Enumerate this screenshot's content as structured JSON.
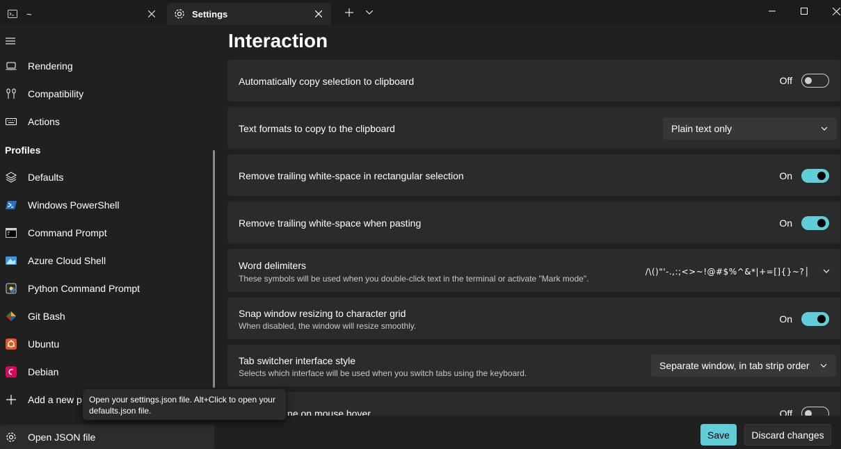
{
  "tabs": [
    {
      "title": "~",
      "icon": "terminal-icon"
    },
    {
      "title": "Settings",
      "icon": "gear-icon"
    }
  ],
  "sidebar": {
    "top_items": [
      {
        "label": "Rendering",
        "icon": "monitor-icon"
      },
      {
        "label": "Compatibility",
        "icon": "compatibility-icon"
      },
      {
        "label": "Actions",
        "icon": "keyboard-icon"
      }
    ],
    "profiles_header": "Profiles",
    "profiles": [
      {
        "label": "Defaults",
        "icon": "layers-icon"
      },
      {
        "label": "Windows PowerShell",
        "icon": "powershell-icon"
      },
      {
        "label": "Command Prompt",
        "icon": "cmd-icon"
      },
      {
        "label": "Azure Cloud Shell",
        "icon": "azure-icon"
      },
      {
        "label": "Python Command Prompt",
        "icon": "python-icon"
      },
      {
        "label": "Git Bash",
        "icon": "git-icon"
      },
      {
        "label": "Ubuntu",
        "icon": "ubuntu-icon"
      },
      {
        "label": "Debian",
        "icon": "debian-icon"
      }
    ],
    "add_new_label": "Add a new p",
    "open_json_label": "Open JSON file"
  },
  "tooltip": "Open your settings.json file. Alt+Click to open your defaults.json file.",
  "main": {
    "title": "Interaction",
    "settings": [
      {
        "title": "Automatically copy selection to clipboard",
        "state_label": "Off",
        "on": false
      },
      {
        "title": "Text formats to copy to the clipboard",
        "dropdown_value": "Plain text only"
      },
      {
        "title": "Remove trailing white-space in rectangular selection",
        "state_label": "On",
        "on": true
      },
      {
        "title": "Remove trailing white-space when pasting",
        "state_label": "On",
        "on": true
      },
      {
        "title": "Word delimiters",
        "description": "These symbols will be used when you double-click text in the terminal or activate \"Mark mode\".",
        "value": "/\\()\"'-.,:;<>~!@#$%^&*|+=[]{}~?│"
      },
      {
        "title": "Snap window resizing to character grid",
        "description": "When disabled, the window will resize smoothly.",
        "state_label": "On",
        "on": true
      },
      {
        "title": "Tab switcher interface style",
        "description": "Selects which interface will be used when you switch tabs using the keyboard.",
        "dropdown_value": "Separate window, in tab strip order"
      },
      {
        "title": "lly focus pane on mouse hover",
        "state_label": "Off",
        "on": false
      }
    ]
  },
  "footer": {
    "save_label": "Save",
    "discard_label": "Discard changes"
  },
  "colors": {
    "accent": "#60cdd8",
    "background": "#202020",
    "card": "#2b2b2b"
  }
}
